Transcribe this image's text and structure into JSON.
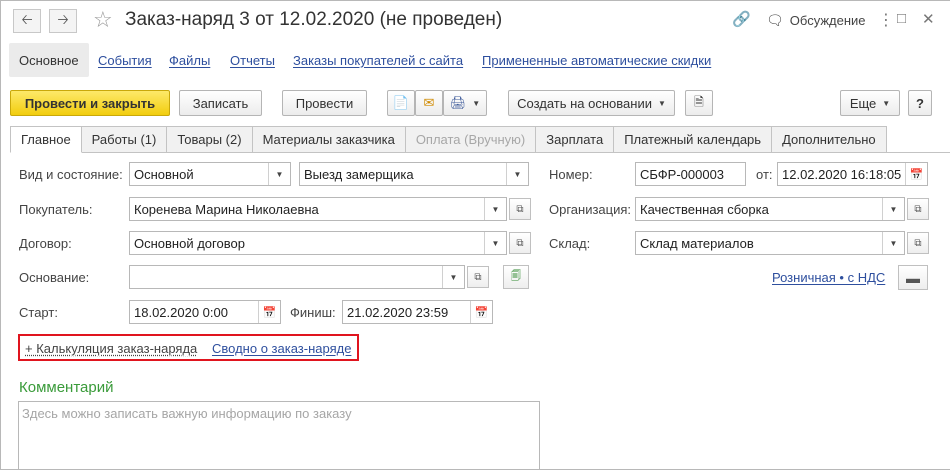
{
  "window": {
    "title": "Заказ-наряд 3 от 12.02.2020 (не проведен)",
    "discussion_label": "Обсуждение",
    "back_icon": "arrow-left-icon",
    "forward_icon": "arrow-right-icon"
  },
  "links": {
    "main": "Основное",
    "events": "События",
    "files": "Файлы",
    "reports": "Отчеты",
    "site_orders": "Заказы покупателей с сайта",
    "discounts": "Примененные автоматические скидки"
  },
  "toolbar": {
    "post_close": "Провести и закрыть",
    "save": "Записать",
    "post": "Провести",
    "create_based": "Создать на основании",
    "more": "Еще"
  },
  "tabs": [
    {
      "label": "Главное"
    },
    {
      "label": "Работы (1)"
    },
    {
      "label": "Товары (2)"
    },
    {
      "label": "Материалы заказчика"
    },
    {
      "label": "Оплата (Вручную)"
    },
    {
      "label": "Зарплата"
    },
    {
      "label": "Платежный календарь"
    },
    {
      "label": "Дополнительно"
    }
  ],
  "form": {
    "kind_label": "Вид и состояние:",
    "kind_value": "Основной",
    "state_value": "Выезд замерщика",
    "buyer_label": "Покупатель:",
    "buyer_value": "Коренева Марина Николаевна",
    "contract_label": "Договор:",
    "contract_value": "Основной договор",
    "basis_label": "Основание:",
    "basis_value": "",
    "start_label": "Старт:",
    "start_value": "18.02.2020  0:00",
    "finish_label": "Финиш:",
    "finish_value": "21.02.2020 23:59",
    "number_label": "Номер:",
    "number_value": "СБФР-000003",
    "date_from_label": "от:",
    "date_value": "12.02.2020 16:18:05",
    "org_label": "Организация:",
    "org_value": "Качественная сборка",
    "warehouse_label": "Склад:",
    "warehouse_value": "Склад материалов",
    "price_link": "Розничная • с НДС",
    "calc_link": "+ Калькуляция заказ-наряда",
    "summary_link": "Сводно о заказ-наряде",
    "comment_title": "Комментарий",
    "comment_placeholder": "Здесь можно записать важную информацию по заказу"
  },
  "colors": {
    "primary_button": "#f2cd0e",
    "link": "#2e4f9e",
    "comment_title": "#3a9b3a",
    "highlight_box": "#e0141e"
  }
}
